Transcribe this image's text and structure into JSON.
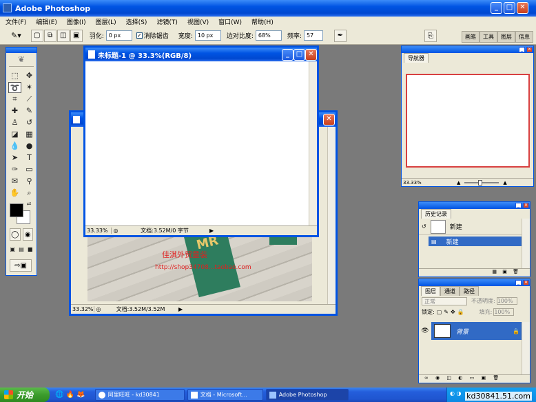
{
  "app": {
    "title": "Adobe Photoshop"
  },
  "menu": [
    "文件(F)",
    "编辑(E)",
    "图像(I)",
    "图层(L)",
    "选择(S)",
    "滤镜(T)",
    "视图(V)",
    "窗口(W)",
    "帮助(H)"
  ],
  "options": {
    "feather_label": "羽化:",
    "feather_value": "0 px",
    "antialias_label": "消除锯齿",
    "width_label": "宽度:",
    "width_value": "10 px",
    "contrast_label": "边对比度:",
    "contrast_value": "68%",
    "frequency_label": "频率:",
    "frequency_value": "57"
  },
  "well_tabs": [
    "画笔",
    "工具",
    "图层",
    "信息"
  ],
  "doc_front": {
    "title": "未标题-1 @ 33.3%(RGB/8)",
    "zoom": "33.33%",
    "status": "文档:3.52M/0 字节"
  },
  "doc_back": {
    "zoom": "33.32%",
    "status": "文档:3.52M/3.52M",
    "watermark_line1": "佳淇外贸童装",
    "watermark_line2": "http://shop34708...taobao.com"
  },
  "navigator": {
    "title": "导航器",
    "zoom": "33.33%"
  },
  "history": {
    "title": "历史记录",
    "snapshot": "新建",
    "state": "新建"
  },
  "layers": {
    "tabs": [
      "图层",
      "通道",
      "路径"
    ],
    "blend_mode": "正常",
    "opacity_label": "不透明度:",
    "opacity_value": "100%",
    "lock_label": "锁定:",
    "fill_label": "填充:",
    "fill_value": "100%",
    "layer_name": "背景"
  },
  "taskbar": {
    "start": "开始",
    "tasks": [
      "阿里旺旺 - kd30841",
      "文档 - Microsoft...",
      "Adobe Photoshop"
    ],
    "watermark": "kd30841.51.com"
  },
  "colors": {
    "xp_blue": "#0054e3",
    "highlight": "#316ac5",
    "canvas_gray": "#7a7a7a"
  }
}
